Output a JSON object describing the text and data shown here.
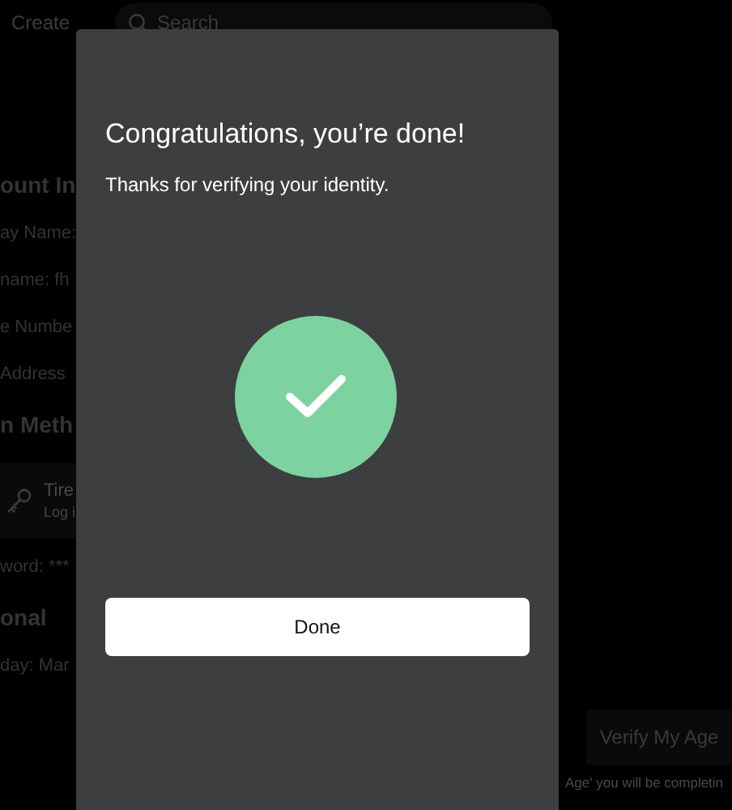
{
  "top_bar": {
    "create_link": "Create",
    "search": {
      "placeholder": "Search"
    }
  },
  "background_left": [
    {
      "kind": "heading",
      "text": "ount In"
    },
    {
      "kind": "line",
      "text": "ay Name:"
    },
    {
      "kind": "line",
      "text": "name: fh"
    },
    {
      "kind": "line",
      "text": "e Numbe"
    },
    {
      "kind": "line",
      "text": "Address"
    },
    {
      "kind": "heading",
      "text": "n Meth"
    },
    {
      "kind": "card",
      "title": "Tire",
      "subtitle": "Log i"
    },
    {
      "kind": "line",
      "text": "word: ***"
    },
    {
      "kind": "heading",
      "text": "onal"
    },
    {
      "kind": "line",
      "text": "day: Mar"
    }
  ],
  "background_right": {
    "button": "Verify My Age",
    "note": "Age' you will be completin"
  },
  "dialog": {
    "title": "Congratulations, you’re done!",
    "message": "Thanks for verifying your identity.",
    "button": "Done"
  }
}
